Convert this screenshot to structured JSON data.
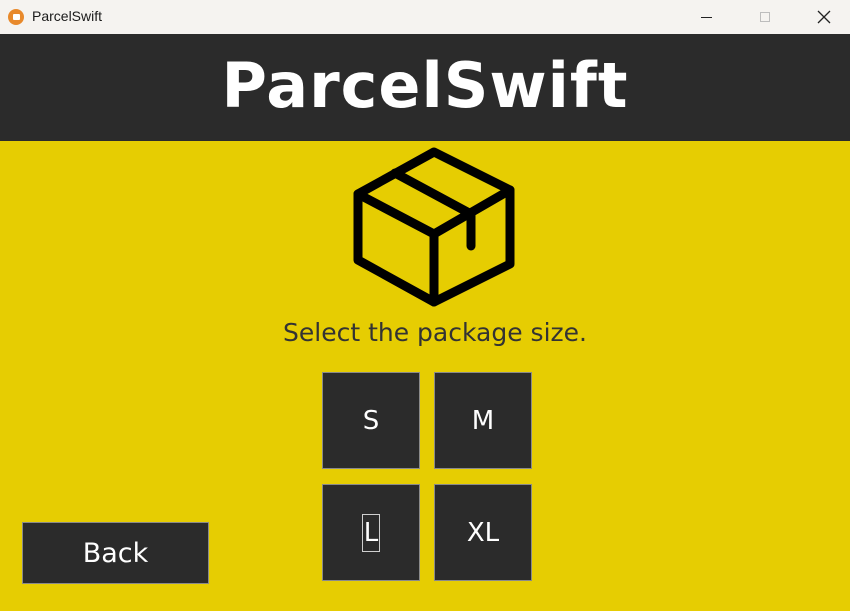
{
  "window": {
    "title": "ParcelSwift",
    "controls": {
      "minimize_icon": "minimize-icon",
      "maximize_icon": "maximize-icon",
      "close_icon": "close-icon"
    }
  },
  "header": {
    "title": "ParcelSwift"
  },
  "main": {
    "icon": "package-box-icon",
    "prompt": "Select the package size.",
    "sizes": [
      {
        "label": "S"
      },
      {
        "label": "M"
      },
      {
        "label": "L"
      },
      {
        "label": "XL"
      }
    ],
    "back_label": "Back"
  },
  "colors": {
    "background": "#e6cd02",
    "header_bg": "#2b2b2b",
    "button_bg": "#2b2b2b",
    "button_text": "#ffffff",
    "prompt_text": "#333333"
  }
}
